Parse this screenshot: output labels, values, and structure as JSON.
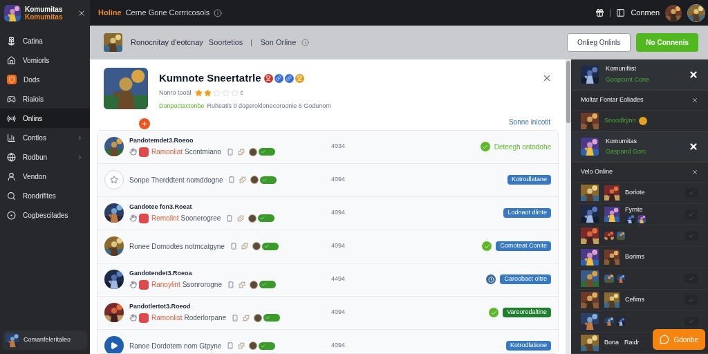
{
  "topbar": {
    "brand_title": "Komumitas",
    "brand_subtitle": "Komumitas",
    "section": "Holine",
    "title": "Cerne Gone Corrricosols",
    "user": "Conmen"
  },
  "sidebar": {
    "items": [
      {
        "label": "Catina",
        "selected": false,
        "submenu": false
      },
      {
        "label": "Vomiorls",
        "selected": false,
        "submenu": false
      },
      {
        "label": "Dods",
        "selected": false,
        "submenu": false
      },
      {
        "label": "Riaiois",
        "selected": false,
        "submenu": false
      },
      {
        "label": "Onlins",
        "selected": true,
        "submenu": false
      },
      {
        "label": "Contlos",
        "selected": false,
        "submenu": true
      },
      {
        "label": "Rodbun",
        "selected": false,
        "submenu": true
      },
      {
        "label": "Vendon",
        "selected": false,
        "submenu": false
      },
      {
        "label": "Rondrifites",
        "selected": false,
        "submenu": false
      },
      {
        "label": "Cogbescilades",
        "selected": false,
        "submenu": false
      }
    ],
    "user": "Comanfeleritaleo"
  },
  "subheader": {
    "title": "Ronocnitay d'eotcnay",
    "subtitle": "Soortetios",
    "status": "Son Orline",
    "buttons": [
      {
        "label": "Onlieg Onlinls",
        "kind": "outline"
      },
      {
        "label": "No Connenis",
        "kind": "primary"
      }
    ]
  },
  "game": {
    "title": "Kumnote Sneertatrle",
    "meta": "Nonro tooäl",
    "stars": 2,
    "rating_suffix": "c",
    "tagline": "Donpoctactonbe",
    "description": "Ruheatis 0 dogeroklonecoroonie 6 Godunom",
    "link": "Sonne inicotit"
  },
  "rows": [
    {
      "title": "Pandotemdet3.Roeoo",
      "tag": "Ramonliat",
      "text": "Scontmiano",
      "number": "4034",
      "status_icon": {
        "kind": "check"
      },
      "badge": {
        "label": "Deteegh ontodohe",
        "kind": "text"
      }
    },
    {
      "avatar": {
        "kind": "star"
      },
      "text": "Sonpe Therddtent nomddogne",
      "number": "4094",
      "badge": {
        "label": "Kotrodlatane",
        "kind": "blue"
      }
    },
    {
      "title": "Gandotee fon3.Roeat",
      "tag": "Remolint",
      "text": "Soonerogree",
      "number": "4094",
      "badge": {
        "label": "Lodnaot dlinte",
        "kind": "blue"
      }
    },
    {
      "text": "Ronee Domodtes notmcatgyne",
      "number": "4094",
      "status_icon": {
        "kind": "check"
      },
      "badge": {
        "label": "Comoteat Conite",
        "kind": "blue"
      }
    },
    {
      "title": "Gandotendet3.Roeoa",
      "tag": "Ranoylint",
      "text": "Ssonrorogne",
      "number": "4494",
      "status_icon": {
        "kind": "clock"
      },
      "badge": {
        "label": "Caroobact oltre",
        "kind": "blue"
      }
    },
    {
      "title": "Pandotlertot3.Roeod",
      "tag": "Ramonlist",
      "text": "Roderlorpane",
      "number": "4094",
      "status_icon": {
        "kind": "check"
      },
      "badge": {
        "label": "Vareoredaltine",
        "kind": "green"
      }
    },
    {
      "avatar": {
        "kind": "play"
      },
      "text": "Ranoe Dordotem nom Gtpyne",
      "number": "4094",
      "badge": {
        "label": "Kotrodlatione",
        "kind": "blue"
      }
    }
  ],
  "right_panel": {
    "blocks": [
      {
        "kind": "card",
        "name": "Komunifiist",
        "status": "Goopcont Cone"
      },
      {
        "kind": "section",
        "title": "Moltar Fontar Eoliades",
        "rows": [
          {
            "status": "Snoodlrÿnn"
          }
        ]
      },
      {
        "kind": "card",
        "name": "Komumitas",
        "status": "Gaspand Gorc"
      },
      {
        "kind": "section",
        "title": "Velo Online",
        "rows": [
          {
            "name": "Borlote",
            "checked": true
          },
          {
            "name": "Fyrnte",
            "icons": true,
            "checked": true
          },
          {
            "icons": true,
            "checked": true
          },
          {
            "name": "Borims"
          },
          {
            "icons": true,
            "checked": true
          },
          {
            "name": "Cefims",
            "checked": true
          },
          {
            "icons": true,
            "checked": true
          },
          {
            "name": "Bona",
            "extra": "Raidr"
          }
        ]
      }
    ]
  },
  "chat_button": "Gdonbe"
}
